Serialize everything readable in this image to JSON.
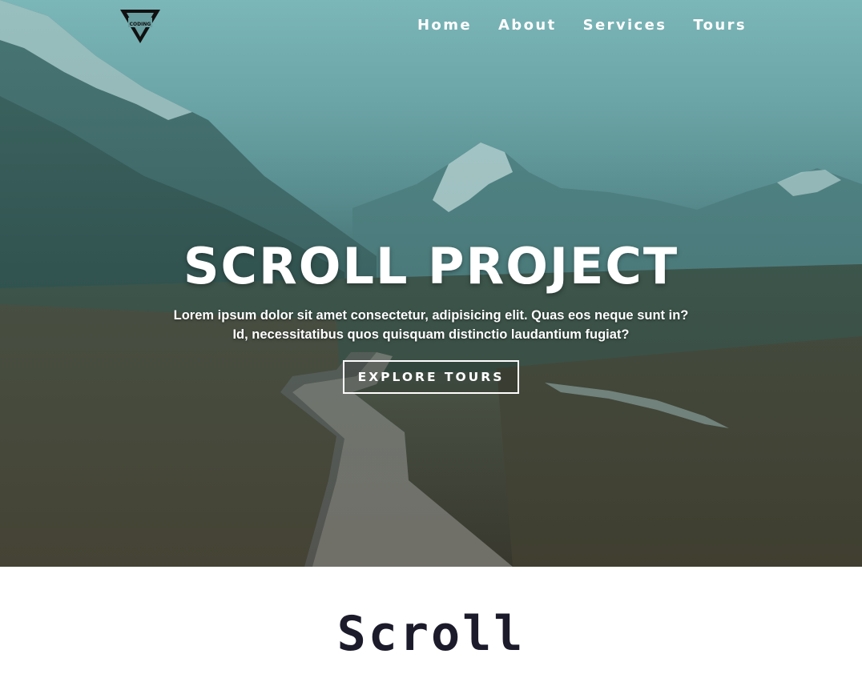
{
  "logo": {
    "icon": "coding-addict-logo",
    "text": "CODING"
  },
  "nav": {
    "items": [
      {
        "label": "Home"
      },
      {
        "label": "About"
      },
      {
        "label": "Services"
      },
      {
        "label": "Tours"
      }
    ]
  },
  "hero": {
    "title": "SCROLL PROJECT",
    "text": "Lorem ipsum dolor sit amet consectetur, adipisicing elit. Quas eos neque sunt in? Id, necessitatibus quos quisquam distinctio laudantium fugiat?",
    "button_label": "EXPLORE TOURS",
    "background": "mountain-boardwalk-photo"
  },
  "page": {
    "heading": "Scroll"
  },
  "colors": {
    "hero_tint": "#6fa3a6",
    "text_dark": "#1b1b2b",
    "white": "#ffffff"
  }
}
